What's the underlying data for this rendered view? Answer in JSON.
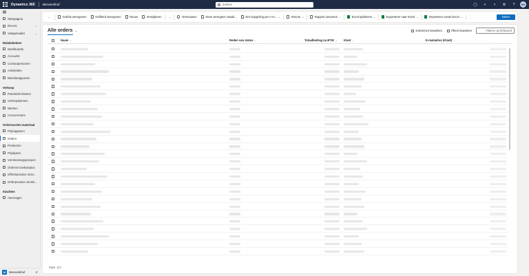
{
  "app": {
    "brand": "Dynamics 365",
    "area": "Mensenkhof",
    "search_placeholder": "Zoeken",
    "avatar_initials": "MG",
    "top_icons": [
      "lightbulb-icon",
      "plus-icon",
      "filter-icon",
      "gear-icon",
      "help-icon"
    ]
  },
  "sidebar": {
    "top_items": [
      {
        "label": "Startpagina",
        "icon": "home-icon"
      },
      {
        "label": "Recent",
        "icon": "clock-icon",
        "chevron": true
      },
      {
        "label": "Vastgemaakt",
        "icon": "pin-icon",
        "chevron": true
      }
    ],
    "groups": [
      {
        "title": "Relatiebeheer",
        "items": [
          {
            "label": "Dashboards"
          },
          {
            "label": "Accounts"
          },
          {
            "label": "Contactpersonen"
          },
          {
            "label": "Activiteiten"
          },
          {
            "label": "Beleidsrapporten"
          }
        ]
      },
      {
        "title": "Verkoop",
        "items": [
          {
            "label": "Potentiële klanten"
          },
          {
            "label": "Verkoopkansen"
          },
          {
            "label": "Werken"
          },
          {
            "label": "Concurrenten"
          }
        ]
      },
      {
        "title": "Ordersoorten materiaal",
        "items": [
          {
            "label": "Prijsopgaven"
          },
          {
            "label": "Orders",
            "active": true
          },
          {
            "label": "Producten"
          },
          {
            "label": "Prijslijsten"
          },
          {
            "label": "Verrekeningsgroepen"
          },
          {
            "label": "Orderverzoeksstatus"
          },
          {
            "label": "Offerteproduct omni..."
          },
          {
            "label": "Orderproduct omnek..."
          }
        ]
      },
      {
        "title": "Klachten",
        "items": [
          {
            "label": "Aanvragen"
          }
        ]
      }
    ],
    "footer": {
      "tile": "M",
      "name": "Mensenkhof"
    }
  },
  "commandbar": {
    "items": [
      {
        "label": "Grafiek weergeven"
      },
      {
        "label": "Gefilterd weergeven"
      },
      {
        "label": "Nieuw",
        "icon": "plus-icon"
      },
      {
        "label": "Verwijderen",
        "icon": "trash-icon",
        "dropdown": true
      },
      {
        "label": "Vernieuwen",
        "icon": "refresh-icon"
      },
      {
        "label": "Deze weergave visuali...",
        "icon": "visual-icon"
      },
      {
        "label": "Een koppeling per e-m...",
        "icon": "link-icon",
        "dropdown": true
      },
      {
        "label": "Stroom",
        "icon": "flow-icon",
        "dropdown": true
      },
      {
        "label": "Rapport uitvoeren",
        "icon": "report-icon",
        "dropdown": true
      },
      {
        "label": "Excel-sjablonen",
        "icon": "excel-icon",
        "dropdown": true
      },
      {
        "label": "Exporteren naar Excel",
        "icon": "excel-icon",
        "dropdown": true
      },
      {
        "label": "Importeren vanuit Excel",
        "icon": "excel-icon",
        "dropdown": true
      }
    ],
    "share_label": "Delen"
  },
  "view": {
    "title": "Alle orders",
    "edit_columns_label": "Kolommen bewerken",
    "edit_filters_label": "Filters bewerken",
    "filter_placeholder": "Filteren op trefwoord",
    "columns": [
      "Naam",
      "Reden van status",
      "Totaalbedrag na BTW",
      "Klant",
      "E-mailadres (Klant)"
    ],
    "row_count": 28,
    "footer_text": "Rijen: 117"
  }
}
